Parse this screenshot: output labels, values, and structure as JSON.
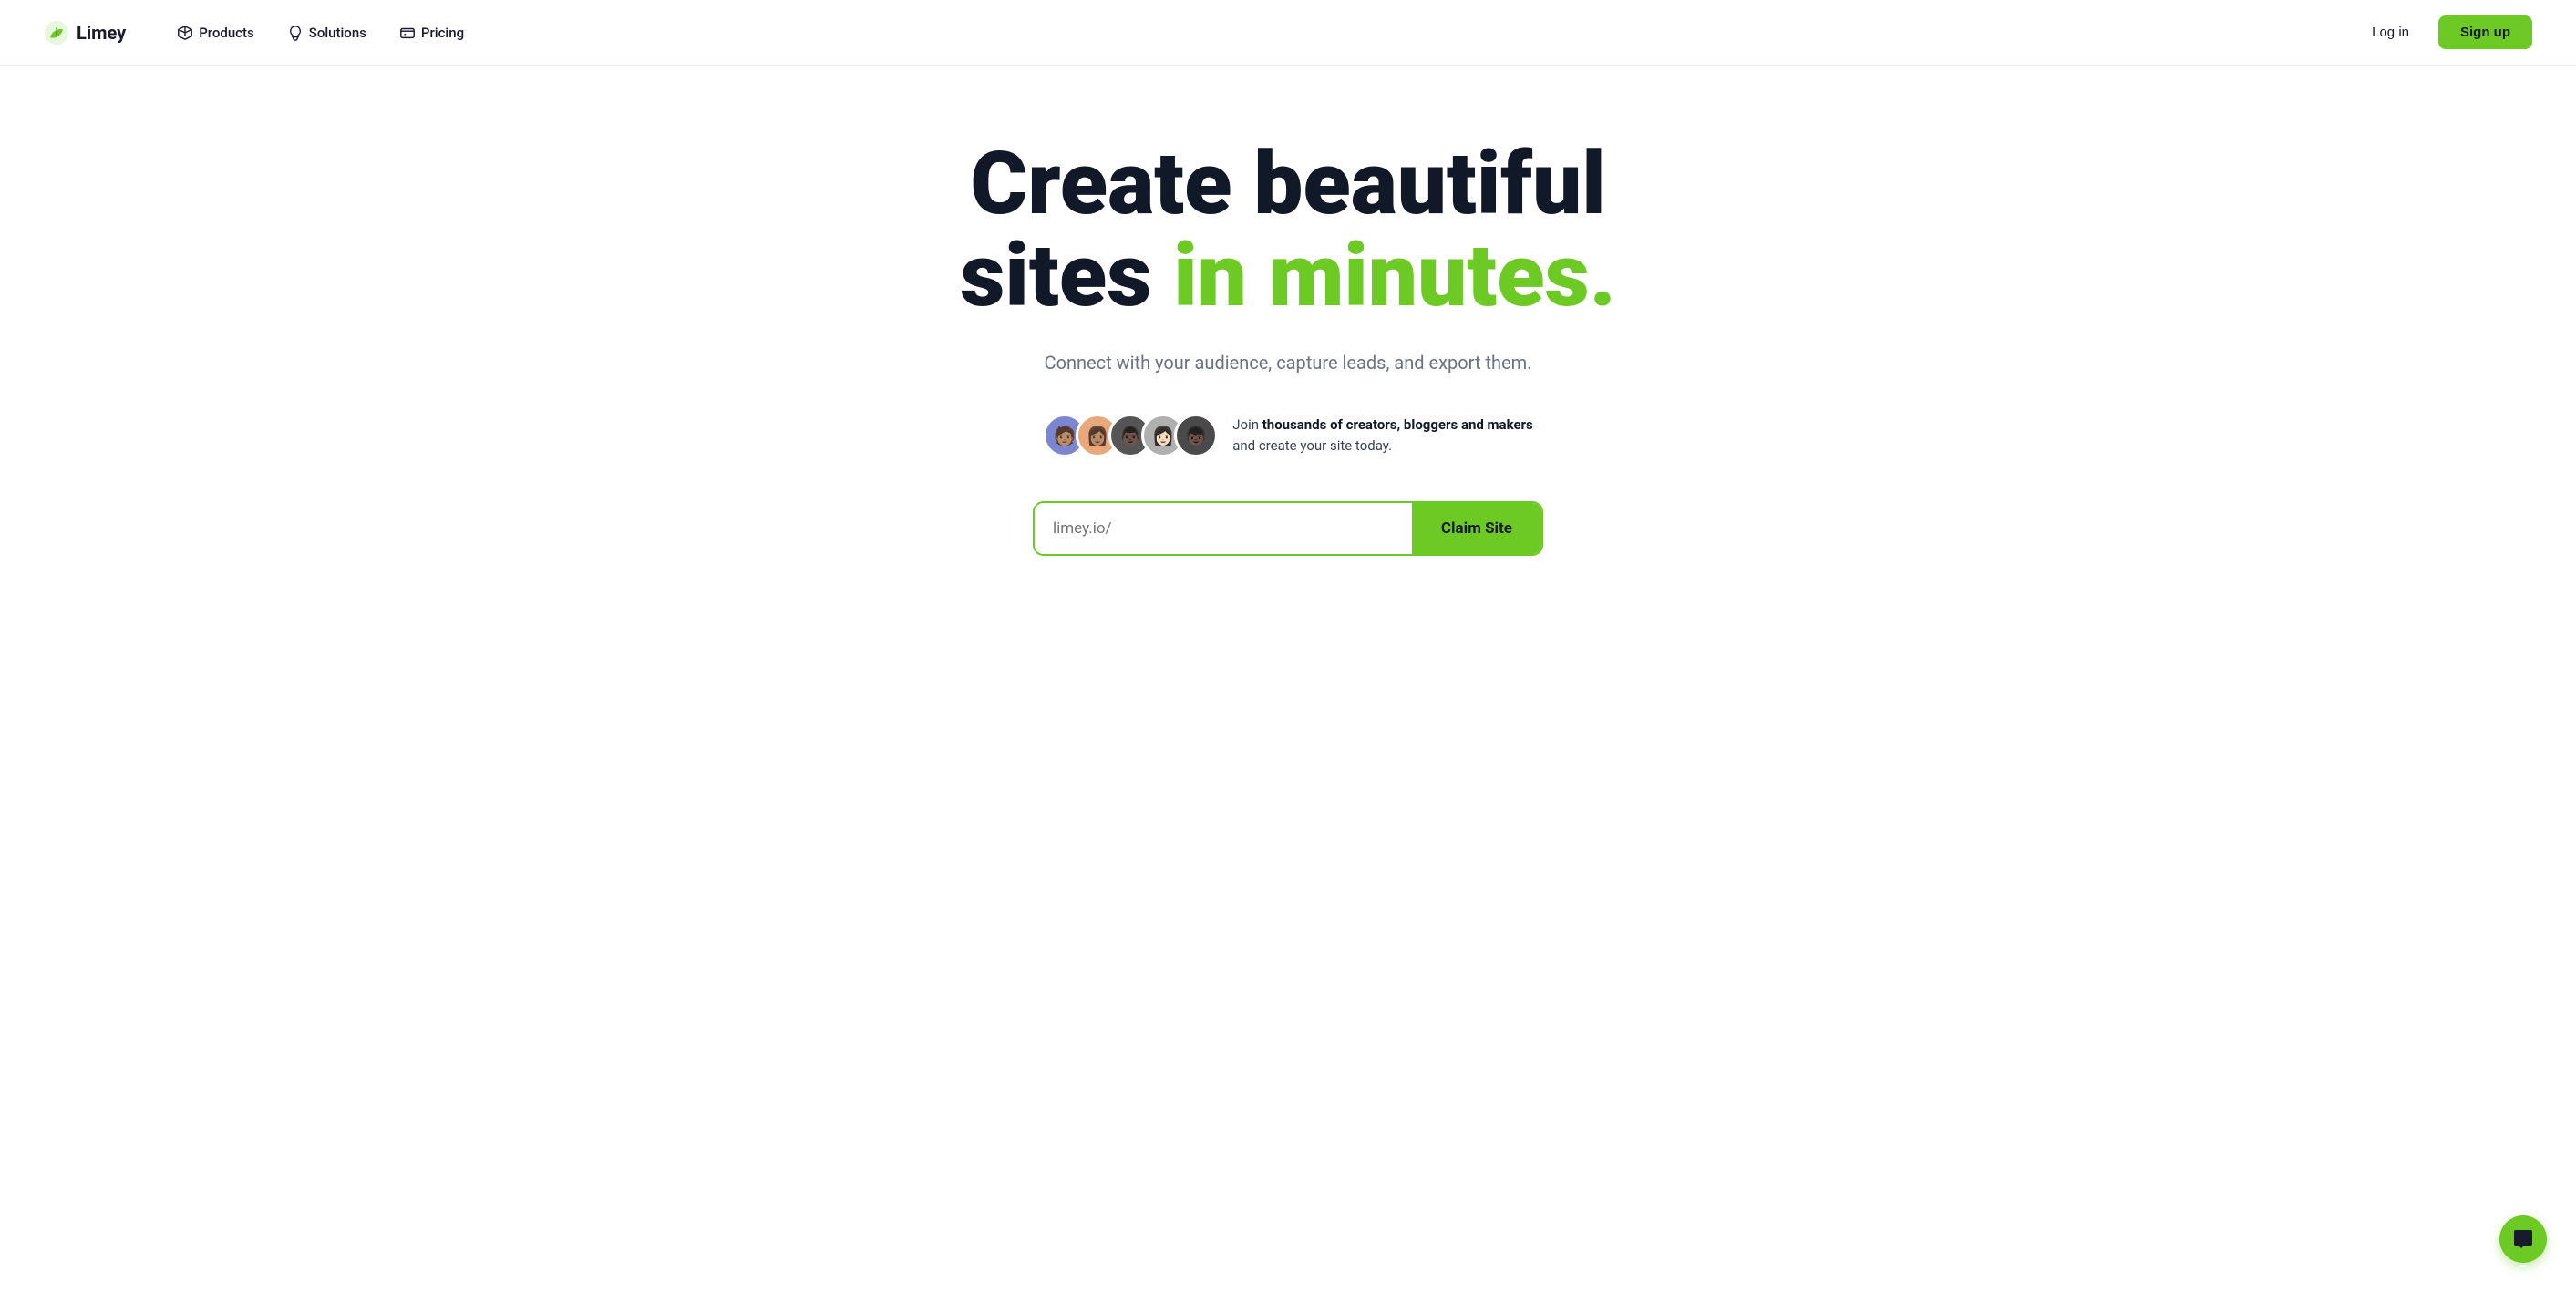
{
  "nav": {
    "logo_text": "Limey",
    "items": [
      {
        "label": "Products",
        "icon": "box-icon"
      },
      {
        "label": "Solutions",
        "icon": "bulb-icon"
      },
      {
        "label": "Pricing",
        "icon": "card-icon"
      }
    ],
    "login_label": "Log in",
    "signup_label": "Sign up"
  },
  "hero": {
    "headline_line1": "Create beautiful",
    "headline_line2_plain": "sites ",
    "headline_line2_accent": "in minutes.",
    "subtitle": "Connect with your audience, capture leads, and export them.",
    "social_proof_text_bold": "thousands of creators, bloggers and makers",
    "social_proof_text_plain": "and create your site today.",
    "social_proof_prefix": "Join ",
    "cta_placeholder": "limey.io/",
    "cta_button_label": "Claim Site"
  },
  "chat": {
    "label": "chat-button"
  },
  "colors": {
    "accent": "#6dc923",
    "dark": "#111827",
    "muted": "#6b7280"
  }
}
